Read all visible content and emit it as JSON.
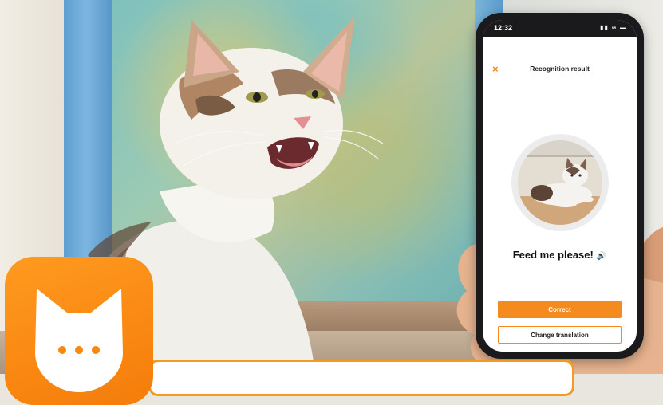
{
  "phone": {
    "status_time": "12:32",
    "status_icons": "▮▮ ≋ ▬",
    "close_label": "×",
    "title": "Recognition result",
    "phrase": "Feed me please!",
    "speaker_icon": "speaker-icon",
    "speaker_glyph": "🔊",
    "correct_label": "Correct",
    "change_label": "Change translation"
  },
  "app_icon": {
    "name": "cat-chat-app-icon",
    "dots": "•••"
  },
  "colors": {
    "accent": "#f58a1f",
    "app_icon_orange": "#f7860f",
    "banner_border": "#f39a22"
  }
}
